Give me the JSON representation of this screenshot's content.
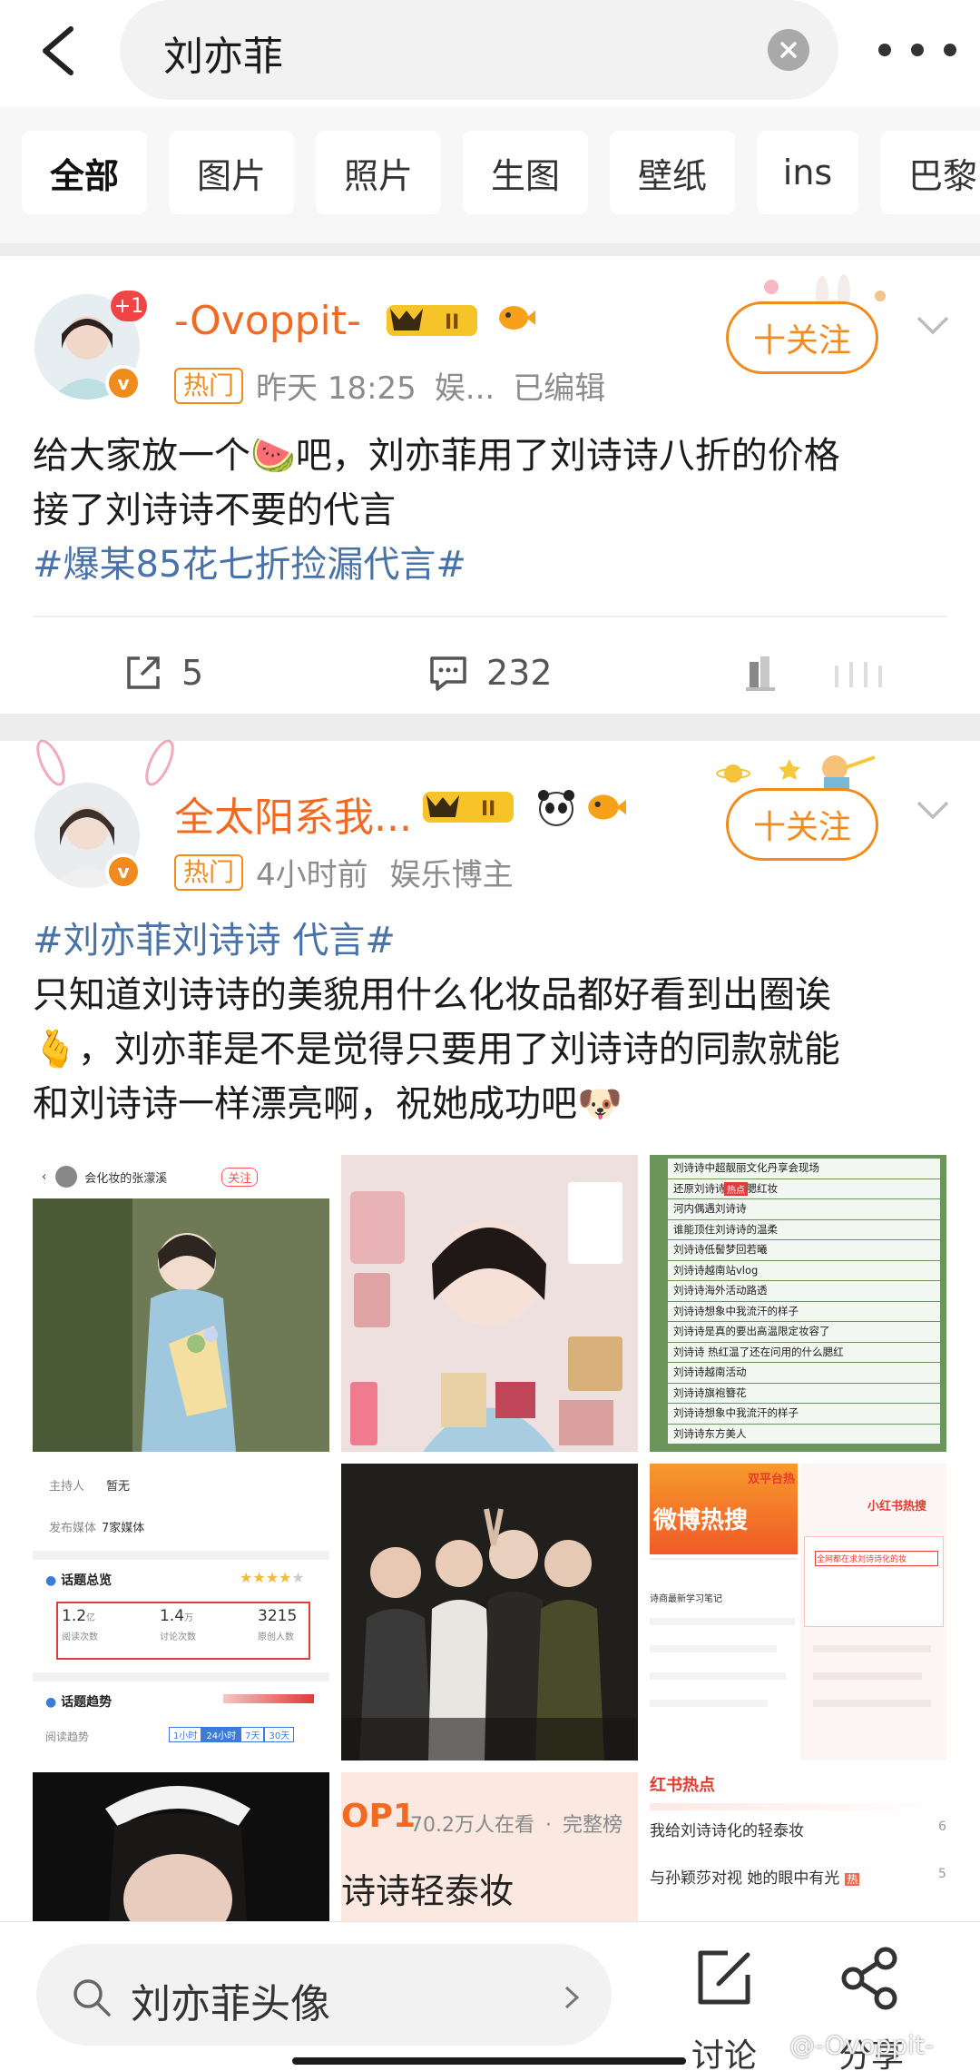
{
  "header": {
    "query": "刘亦菲",
    "back_icon": "chevron-left-icon",
    "clear_icon": "close-icon",
    "more_icon": "more-dots-icon"
  },
  "filters": [
    "全部",
    "图片",
    "照片",
    "生图",
    "壁纸",
    "ins",
    "巴黎"
  ],
  "posts": [
    {
      "username": "-Ovoppit-",
      "notif_count": "+1",
      "vip_label": "II",
      "hot_badge": "热门",
      "time": "昨天 18:25",
      "source": "娱...",
      "edited": "已编辑",
      "follow_label": "十关注",
      "text_line1": "给大家放一个🍉吧，刘亦菲用了刘诗诗八折的价格",
      "text_line2": "接了刘诗诗不要的代言",
      "topic": "#爆某85花七折捡漏代言#",
      "repost_count": "5",
      "comment_count": "232"
    },
    {
      "username": "全太阳系我...",
      "vip_label": "II",
      "hot_badge": "热门",
      "time": "4小时前",
      "source": "娱乐博主",
      "follow_label": "十关注",
      "topic": "#刘亦菲刘诗诗 代言#",
      "text_line1": "只知道刘诗诗的美貌用什么化妆品都好看到出圈诶",
      "text_line2": "🫰，刘亦菲是不是觉得只要用了刘诗诗的同款就能",
      "text_line3": "和刘诗诗一样漂亮啊，祝她成功吧🐶",
      "thumb_texts": {
        "t1_name": "会化妆的张濛溪",
        "t1_follow": "关注",
        "t3_lines": [
          "刘诗诗中超靓丽文化丹享会现场",
          "还原刘诗诗高温腮红妆",
          "河内偶遇刘诗诗",
          "谁能顶住刘诗诗的温柔",
          "刘诗诗低髻梦回若曦",
          "刘诗诗越南站vlog",
          "刘诗诗海外活动路透",
          "刘诗诗想象中我流汗的样子",
          "刘诗诗是真的要出高温限定妆容了",
          "刘诗诗 热红温了还在问用的什么腮红",
          "刘诗诗越南活动",
          "刘诗诗旗袍簪花",
          "刘诗诗想象中我流汗的样子",
          "刘诗诗东方美人"
        ],
        "t3_hot": "热点",
        "t4_host_label": "主持人",
        "t4_host_value": "暂无",
        "t4_media_label": "发布媒体",
        "t4_media_value": "7家媒体",
        "t4_overview": "话题总览",
        "t4_reads": "1.2",
        "t4_reads_unit": "亿",
        "t4_reads_label": "阅读次数",
        "t4_discuss": "1.4",
        "t4_discuss_unit": "万",
        "t4_discuss_label": "讨论次数",
        "t4_orig": "3215",
        "t4_orig_label": "原创人数",
        "t4_trend": "话题趋势",
        "t4_trend_label": "阅读趋势",
        "t4_tabs": [
          "1小时",
          "24小时",
          "7天",
          "30天"
        ],
        "t6_badge": "双平台热",
        "t6_weibo": "微博热搜",
        "t6_xhs": "小红书热搜",
        "t6_item": "全网都在求刘诗诗化的妆",
        "t6_line": "诗商最新学习笔记",
        "t8_rank": "OP1",
        "t8_watching": "70.2万人在看",
        "t8_dot": "·",
        "t8_more": "完整榜",
        "t8_title": "诗诗轻泰妆",
        "t9_title": "红书热点",
        "t9_line1": "我给刘诗诗化的轻泰妆",
        "t9_num1": "6",
        "t9_line2": "与孙颖莎对视 她的眼中有光",
        "t9_hot": "热",
        "t9_num2": "5"
      }
    }
  ],
  "bottom": {
    "suggest": "刘亦菲头像",
    "discuss": "讨论",
    "share": "分享",
    "watermark": "@-Ovoppit-"
  },
  "colors": {
    "accent": "#f28b1d",
    "username": "#f26a21",
    "topic": "#4872a8"
  }
}
